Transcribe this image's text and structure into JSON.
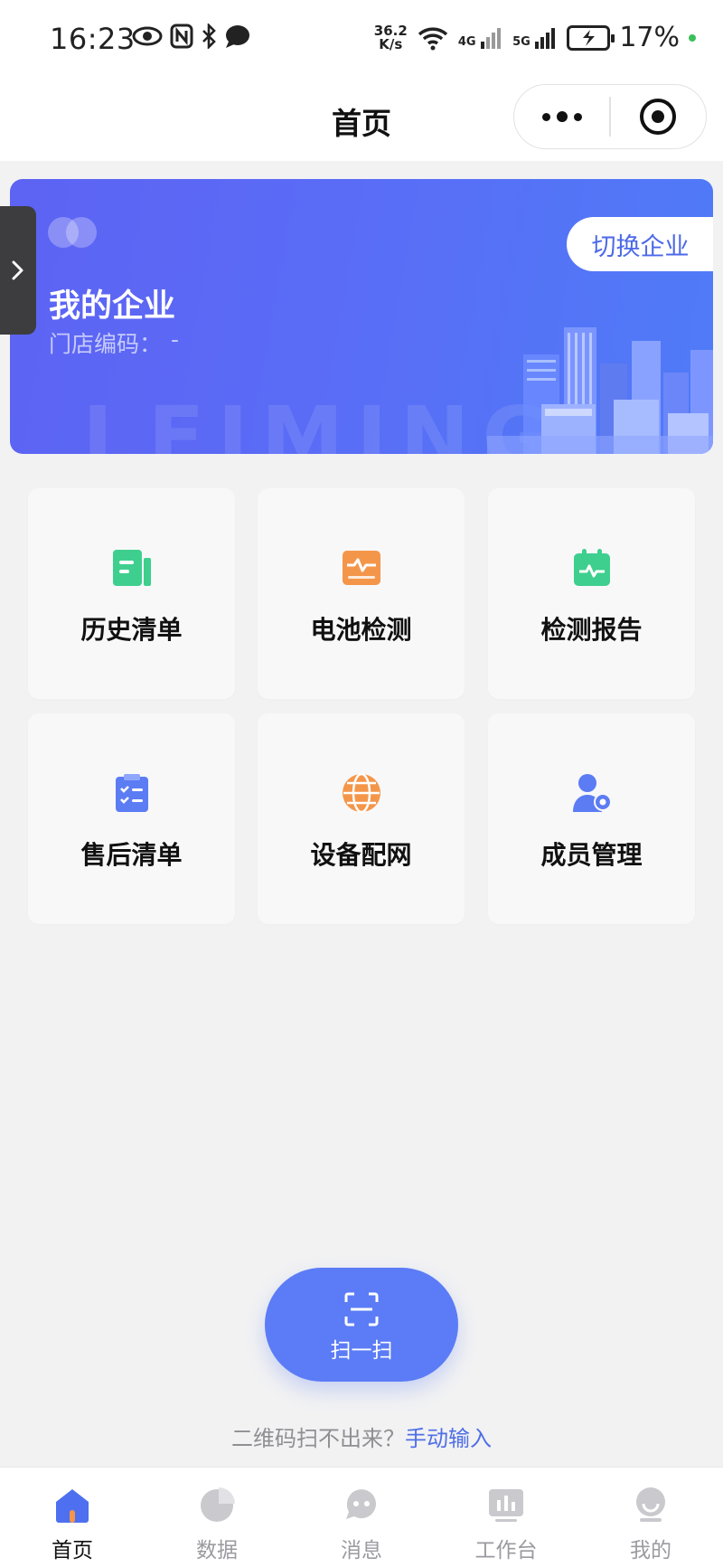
{
  "status_bar": {
    "time": "16:23",
    "net_speed_value": "36.2",
    "net_speed_unit": "K/s",
    "signal_1": "4G",
    "signal_2": "5G",
    "battery": "17%",
    "left_icons": [
      "eye-icon",
      "nfc-icon",
      "bluetooth-icon",
      "chat-bubble-icon"
    ]
  },
  "nav": {
    "title": "首页"
  },
  "banner": {
    "title": "我的企业",
    "store_code_label": "门店编码：",
    "store_code_value": "-",
    "switch_label": "切换企业",
    "watermark": "LEIMING"
  },
  "features": [
    {
      "label": "历史清单",
      "icon": "history-list-icon",
      "color": "#3ecf8e"
    },
    {
      "label": "电池检测",
      "icon": "battery-test-icon",
      "color": "#f4964a"
    },
    {
      "label": "检测报告",
      "icon": "report-icon",
      "color": "#3ecf8e"
    },
    {
      "label": "售后清单",
      "icon": "checklist-icon",
      "color": "#5c7cf4"
    },
    {
      "label": "设备配网",
      "icon": "network-globe-icon",
      "color": "#f4964a"
    },
    {
      "label": "成员管理",
      "icon": "member-settings-icon",
      "color": "#5c7cf4"
    }
  ],
  "scan": {
    "label": "扫一扫"
  },
  "manual_input": {
    "prompt": "二维码扫不出来？",
    "link": "手动输入"
  },
  "tabs": [
    {
      "label": "首页",
      "icon": "home-icon",
      "active": true
    },
    {
      "label": "数据",
      "icon": "pie-chart-icon",
      "active": false
    },
    {
      "label": "消息",
      "icon": "message-icon",
      "active": false
    },
    {
      "label": "工作台",
      "icon": "workbench-icon",
      "active": false
    },
    {
      "label": "我的",
      "icon": "profile-icon",
      "active": false
    }
  ],
  "colors": {
    "accent": "#5b7cf6",
    "banner_start": "#5d63f3",
    "banner_end": "#4f7bf7",
    "link": "#4f6fe5"
  }
}
